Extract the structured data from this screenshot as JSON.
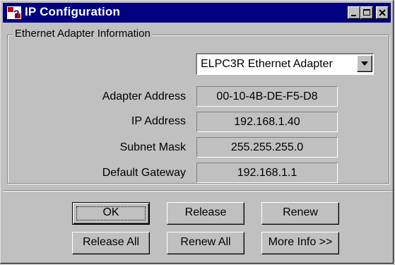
{
  "window": {
    "title": "IP Configuration",
    "icon": "network-config-icon"
  },
  "titlebar_buttons": [
    "minimize-icon",
    "maximize-icon",
    "close-icon"
  ],
  "group": {
    "label": "Ethernet  Adapter Information"
  },
  "adapter": {
    "selected": "ELPC3R Ethernet Adapter"
  },
  "fields": [
    {
      "label": "Adapter Address",
      "value": "00-10-4B-DE-F5-D8"
    },
    {
      "label": "IP Address",
      "value": "192.168.1.40"
    },
    {
      "label": "Subnet Mask",
      "value": "255.255.255.0"
    },
    {
      "label": "Default Gateway",
      "value": "192.168.1.1"
    }
  ],
  "buttons": {
    "ok": "OK",
    "release": "Release",
    "renew": "Renew",
    "release_all": "Release All",
    "renew_all": "Renew All",
    "more_info": "More Info >>"
  },
  "colors": {
    "titlebar": "#000080",
    "face": "#c0c0c0"
  }
}
